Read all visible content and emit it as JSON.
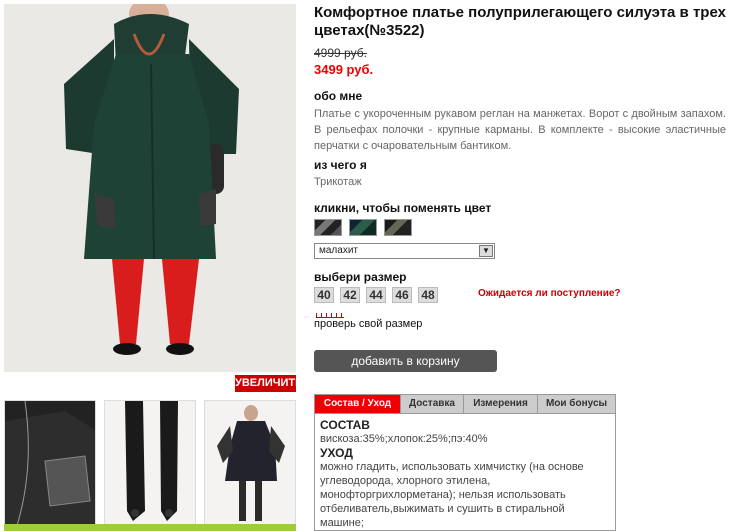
{
  "product": {
    "title": "Комфортное платье полуприлегающего силуэта в трех цветах(№3522)",
    "old_price": "4999 руб.",
    "new_price": "3499 руб."
  },
  "photos": {
    "zoom_label": "УВЕЛИЧИТЬ"
  },
  "about": {
    "heading": "обо мне",
    "text": "Платье с укороченным рукавом реглан на манжетах. Ворот с двойным запахом. В рельефах полочки - крупные карманы. В комплекте - высокие эластичные перчатки с очаровательным бантиком."
  },
  "material": {
    "heading": "из чего я",
    "text": "Трикотаж"
  },
  "color": {
    "heading": "кликни, чтобы поменять цвет",
    "selected": "малахит"
  },
  "size": {
    "heading": "выбери размер",
    "options": [
      "40",
      "42",
      "44",
      "46",
      "48"
    ],
    "notify_link": "Ожидается ли поступление?",
    "check_link": "проверь свой размер"
  },
  "cart": {
    "button_label": "добавить в корзину"
  },
  "tabs": {
    "items": [
      "Состав / Уход",
      "Доставка",
      "Измерения",
      "Мои бонусы"
    ],
    "active_index": 0
  },
  "care": {
    "composition_heading": "СОСТАВ",
    "composition": "вискоза:35%;хлопок:25%;пэ:40%",
    "care_heading": "УХОД",
    "care_text": "можно гладить, использовать химчистку (на основе углеводорода, хлорного этилена, монофторгрихлорметана); нельзя использовать отбеливатель,выжимать и сушить в стиральной машине;"
  },
  "colors": {
    "accent": "#e00000",
    "button": "#555555",
    "tab_bg": "#cccccc"
  }
}
